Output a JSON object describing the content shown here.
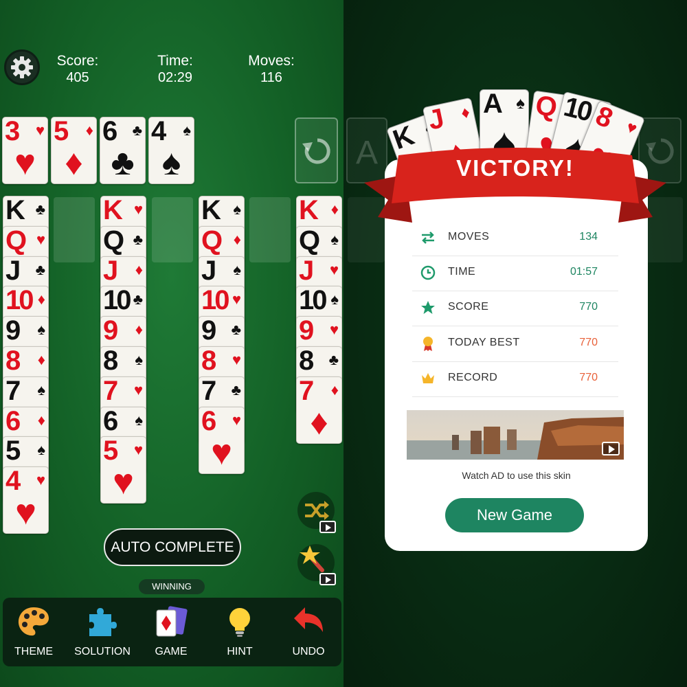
{
  "hud": {
    "score_label": "Score:",
    "score_value": "405",
    "time_label": "Time:",
    "time_value": "02:29",
    "moves_label": "Moves:",
    "moves_value": "116"
  },
  "foundations": [
    {
      "rank": "3",
      "suit": "♥",
      "color": "red"
    },
    {
      "rank": "5",
      "suit": "♦",
      "color": "red"
    },
    {
      "rank": "6",
      "suit": "♣",
      "color": "blk"
    },
    {
      "rank": "4",
      "suit": "♠",
      "color": "blk"
    }
  ],
  "tableau": [
    [
      {
        "rank": "K",
        "suit": "♣",
        "color": "blk"
      },
      {
        "rank": "Q",
        "suit": "♥",
        "color": "red"
      },
      {
        "rank": "J",
        "suit": "♣",
        "color": "blk"
      },
      {
        "rank": "10",
        "suit": "♦",
        "color": "red"
      },
      {
        "rank": "9",
        "suit": "♠",
        "color": "blk"
      },
      {
        "rank": "8",
        "suit": "♦",
        "color": "red"
      },
      {
        "rank": "7",
        "suit": "♠",
        "color": "blk"
      },
      {
        "rank": "6",
        "suit": "♦",
        "color": "red"
      },
      {
        "rank": "5",
        "suit": "♠",
        "color": "blk"
      },
      {
        "rank": "4",
        "suit": "♥",
        "color": "red"
      }
    ],
    [],
    [
      {
        "rank": "K",
        "suit": "♥",
        "color": "red"
      },
      {
        "rank": "Q",
        "suit": "♣",
        "color": "blk"
      },
      {
        "rank": "J",
        "suit": "♦",
        "color": "red"
      },
      {
        "rank": "10",
        "suit": "♣",
        "color": "blk"
      },
      {
        "rank": "9",
        "suit": "♦",
        "color": "red"
      },
      {
        "rank": "8",
        "suit": "♠",
        "color": "blk"
      },
      {
        "rank": "7",
        "suit": "♥",
        "color": "red"
      },
      {
        "rank": "6",
        "suit": "♠",
        "color": "blk"
      },
      {
        "rank": "5",
        "suit": "♥",
        "color": "red"
      }
    ],
    [],
    [
      {
        "rank": "K",
        "suit": "♠",
        "color": "blk"
      },
      {
        "rank": "Q",
        "suit": "♦",
        "color": "red"
      },
      {
        "rank": "J",
        "suit": "♠",
        "color": "blk"
      },
      {
        "rank": "10",
        "suit": "♥",
        "color": "red"
      },
      {
        "rank": "9",
        "suit": "♣",
        "color": "blk"
      },
      {
        "rank": "8",
        "suit": "♥",
        "color": "red"
      },
      {
        "rank": "7",
        "suit": "♣",
        "color": "blk"
      },
      {
        "rank": "6",
        "suit": "♥",
        "color": "red"
      }
    ],
    [],
    [
      {
        "rank": "K",
        "suit": "♦",
        "color": "red"
      },
      {
        "rank": "Q",
        "suit": "♠",
        "color": "blk"
      },
      {
        "rank": "J",
        "suit": "♥",
        "color": "red"
      },
      {
        "rank": "10",
        "suit": "♠",
        "color": "blk"
      },
      {
        "rank": "9",
        "suit": "♥",
        "color": "red"
      },
      {
        "rank": "8",
        "suit": "♣",
        "color": "blk"
      },
      {
        "rank": "7",
        "suit": "♦",
        "color": "red"
      }
    ]
  ],
  "auto_complete_label": "AUTO COMPLETE",
  "winning_label": "WINNING",
  "toolbar": [
    {
      "label": "THEME",
      "icon": "palette-icon"
    },
    {
      "label": "SOLUTION",
      "icon": "puzzle-icon"
    },
    {
      "label": "GAME",
      "icon": "cards-icon"
    },
    {
      "label": "HINT",
      "icon": "lightbulb-icon"
    },
    {
      "label": "UNDO",
      "icon": "undo-arrow-icon"
    }
  ],
  "victory": {
    "title": "VICTORY!",
    "fan_cards": [
      {
        "rank": "K",
        "suit": "♠",
        "color": "blk"
      },
      {
        "rank": "J",
        "suit": "♦",
        "color": "red"
      },
      {
        "rank": "A",
        "suit": "♠",
        "color": "blk"
      },
      {
        "rank": "Q",
        "suit": "♥",
        "color": "red"
      },
      {
        "rank": "10",
        "suit": "♠",
        "color": "blk"
      },
      {
        "rank": "8",
        "suit": "♥",
        "color": "red"
      }
    ],
    "stats": [
      {
        "icon": "swap-arrows-icon",
        "label": "MOVES",
        "value": "134",
        "value_color": "#1e8561"
      },
      {
        "icon": "clock-icon",
        "label": "TIME",
        "value": "01:57",
        "value_color": "#1e8561"
      },
      {
        "icon": "star-icon",
        "label": "SCORE",
        "value": "770",
        "value_color": "#1e8561"
      },
      {
        "icon": "medal-icon",
        "label": "TODAY BEST",
        "value": "770",
        "value_color": "#e8613a"
      },
      {
        "icon": "crown-icon",
        "label": "RECORD",
        "value": "770",
        "value_color": "#e8613a"
      }
    ],
    "ad_text": "Watch AD to use this skin",
    "new_game_label": "New Game"
  },
  "colors": {
    "felt": "#136026",
    "accent_green": "#1e8561",
    "ribbon_red": "#d8231c",
    "highlight_orange": "#e8613a"
  }
}
